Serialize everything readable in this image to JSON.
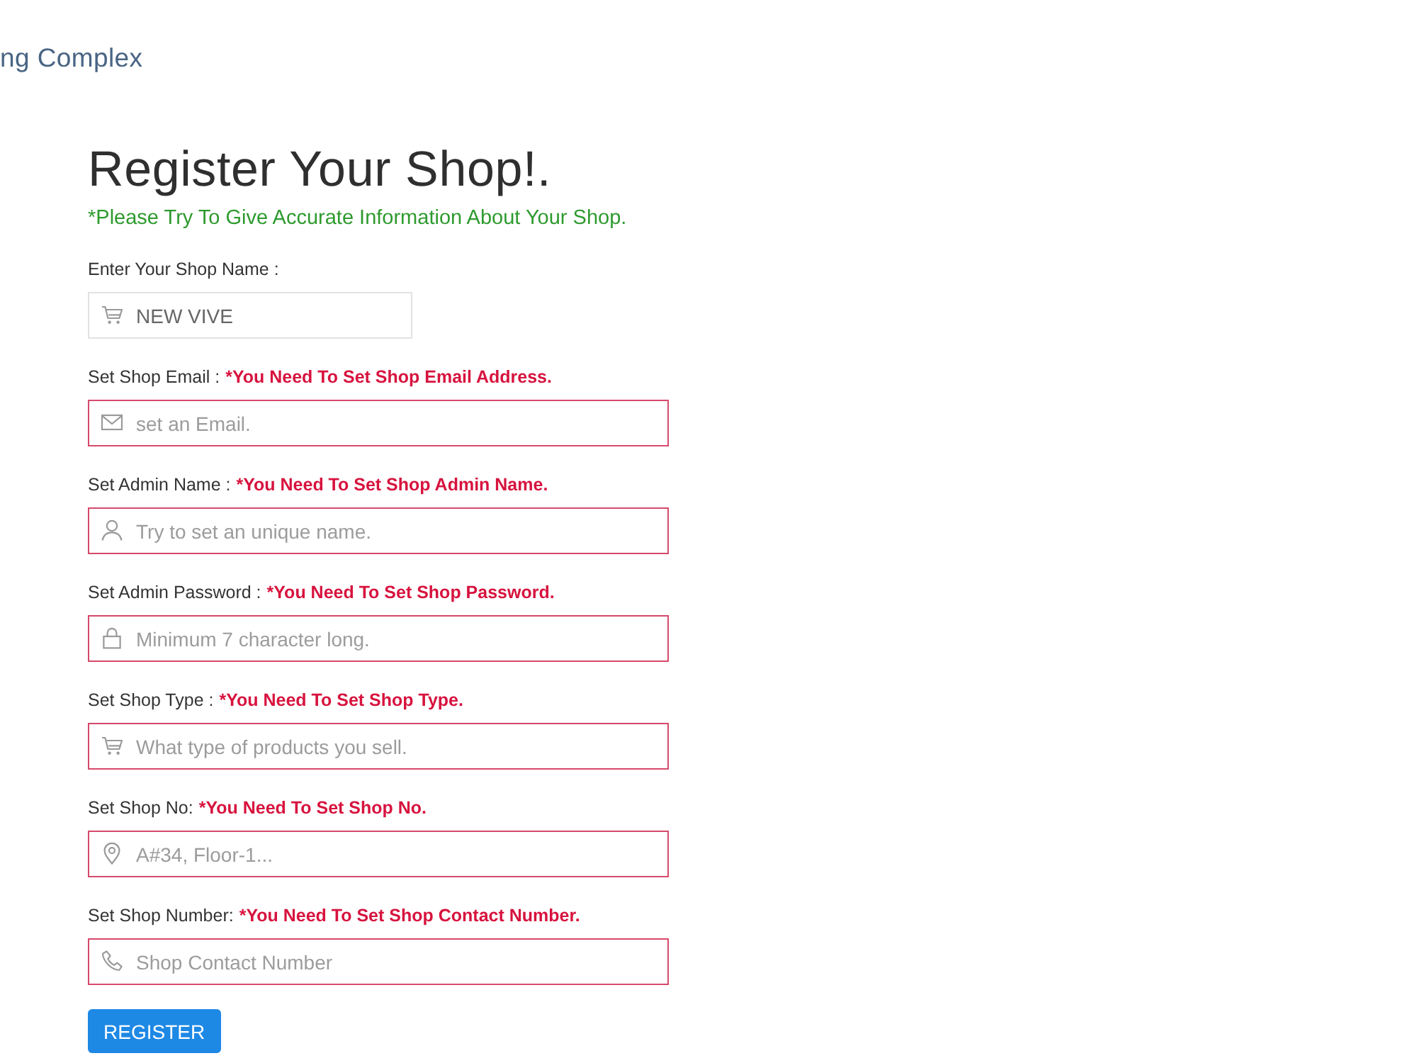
{
  "header": {
    "logo_text": "ng Complex"
  },
  "form": {
    "title": "Register Your Shop!.",
    "note": "*Please Try To Give Accurate Information About Your Shop.",
    "fields": [
      {
        "kind": "shop",
        "label": "Enter Your Shop Name :",
        "value": "NEW VIVE",
        "invalid": false
      },
      {
        "kind": "email",
        "label": "Set Shop Email :",
        "error": "*You Need To Set Shop Email Address.",
        "placeholder": "set an Email.",
        "invalid": true
      },
      {
        "kind": "user",
        "label": "Set Admin Name :",
        "error": "*You Need To Set Shop Admin Name.",
        "placeholder": "Try to set an unique name.",
        "invalid": true
      },
      {
        "kind": "password",
        "label": "Set Admin Password :",
        "error": "*You Need To Set Shop Password.",
        "placeholder": "Minimum 7 character long.",
        "invalid": true
      },
      {
        "kind": "type",
        "label": "Set Shop Type :",
        "error": "*You Need To Set Shop Type.",
        "placeholder": "What type of products you sell.",
        "invalid": true
      },
      {
        "kind": "location",
        "label": "Set Shop No:",
        "error": "*You Need To Set Shop No.",
        "placeholder": "A#34, Floor-1...",
        "invalid": true
      },
      {
        "kind": "phone",
        "label": "Set Shop Number:",
        "error": "*You Need To Set Shop Contact Number.",
        "placeholder": "Shop Contact Number",
        "invalid": true
      }
    ],
    "submit": "REGISTER"
  }
}
